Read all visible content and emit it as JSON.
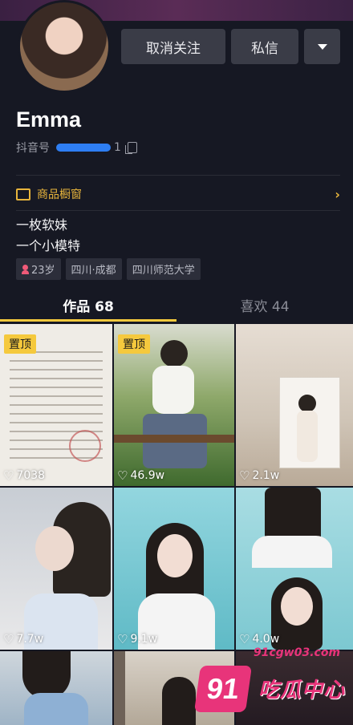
{
  "profile": {
    "name": "Emma",
    "id_label": "抖音号",
    "id_visible_suffix": "1",
    "bio_line1": "一枚软妹",
    "bio_line2": "一个小模特"
  },
  "buttons": {
    "unfollow": "取消关注",
    "message": "私信"
  },
  "shop": {
    "label": "商品橱窗"
  },
  "tags": {
    "age": "23岁",
    "location": "四川·成都",
    "school": "四川师范大学"
  },
  "tabs": {
    "works": "作品 68",
    "likes": "喜欢 44"
  },
  "pinned_label": "置顶",
  "videos": [
    {
      "likes": "7038",
      "pinned": true
    },
    {
      "likes": "46.9w",
      "pinned": true
    },
    {
      "likes": "2.1w",
      "pinned": false
    },
    {
      "likes": "7.7w",
      "pinned": false
    },
    {
      "likes": "9.1w",
      "pinned": false
    },
    {
      "likes": "4.0w",
      "pinned": false
    },
    {
      "likes": "",
      "pinned": false
    },
    {
      "likes": "",
      "pinned": false
    },
    {
      "likes": "",
      "pinned": false
    }
  ],
  "watermark": {
    "number": "91",
    "url": "91cgw03.com",
    "text": "吃瓜中心"
  },
  "colors": {
    "background": "#161823",
    "accent": "#f5c93d",
    "shop": "#e8b53c",
    "button": "#3a3c47",
    "watermark": "#e8347a"
  }
}
